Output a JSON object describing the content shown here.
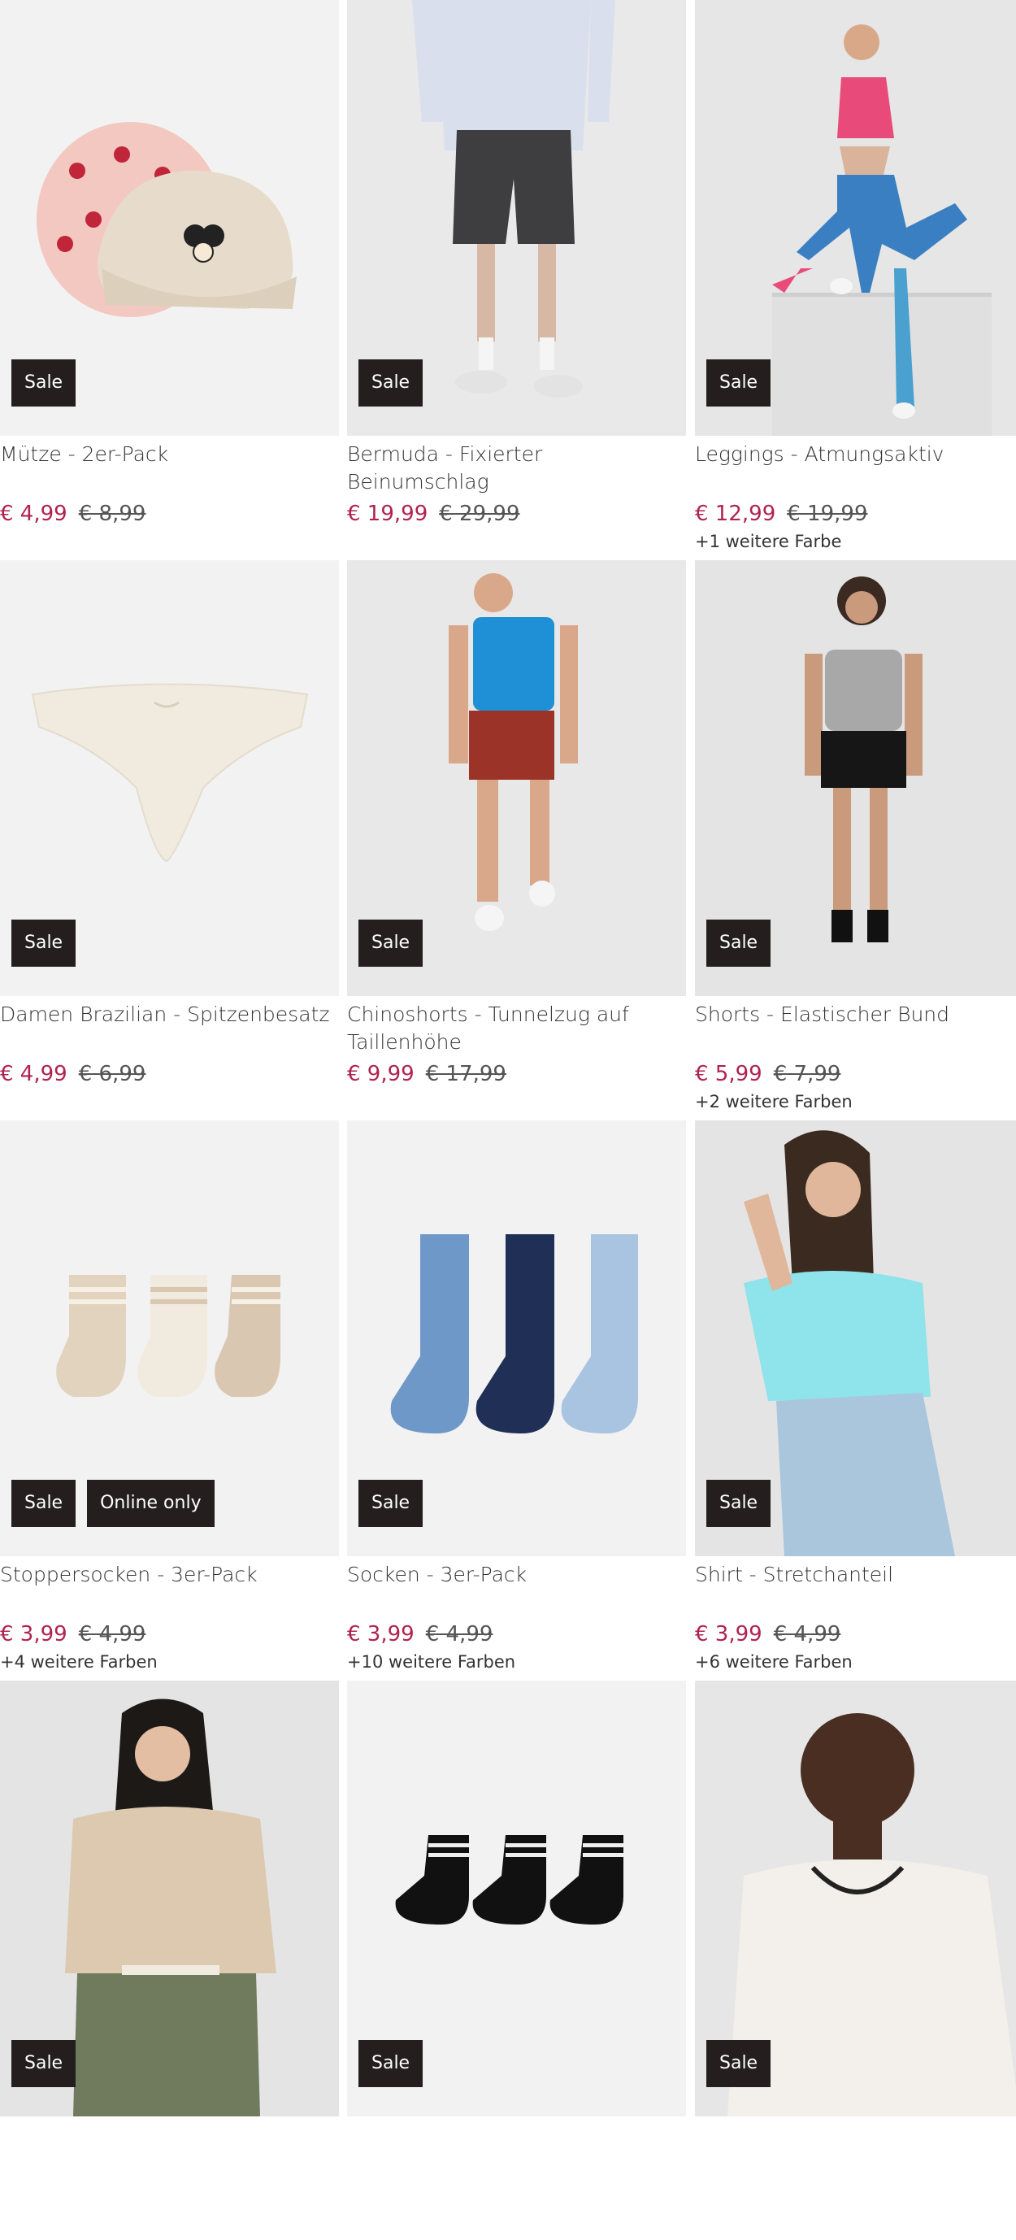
{
  "products": [
    {
      "name": "Mütze - 2er-Pack",
      "price": "€ 4,99",
      "old_price": "€ 8,99",
      "badges": [
        "Sale"
      ],
      "colors": ""
    },
    {
      "name": "Bermuda - Fixierter Beinumschlag",
      "price": "€ 19,99",
      "old_price": "€ 29,99",
      "badges": [
        "Sale"
      ],
      "colors": ""
    },
    {
      "name": "Leggings - Atmungsaktiv",
      "price": "€ 12,99",
      "old_price": "€ 19,99",
      "badges": [
        "Sale"
      ],
      "colors": "+1 weitere Farbe"
    },
    {
      "name": "Damen Brazilian - Spitzenbesatz",
      "price": "€ 4,99",
      "old_price": "€ 6,99",
      "badges": [
        "Sale"
      ],
      "colors": ""
    },
    {
      "name": "Chinoshorts - Tunnelzug auf Taillenhöhe",
      "price": "€ 9,99",
      "old_price": "€ 17,99",
      "badges": [
        "Sale"
      ],
      "colors": ""
    },
    {
      "name": "Shorts - Elastischer Bund",
      "price": "€ 5,99",
      "old_price": "€ 7,99",
      "badges": [
        "Sale"
      ],
      "colors": "+2 weitere Farben"
    },
    {
      "name": "Stoppersocken - 3er-Pack",
      "price": "€ 3,99",
      "old_price": "€ 4,99",
      "badges": [
        "Sale",
        "Online only"
      ],
      "colors": "+4 weitere Farben"
    },
    {
      "name": "Socken - 3er-Pack",
      "price": "€ 3,99",
      "old_price": "€ 4,99",
      "badges": [
        "Sale"
      ],
      "colors": "+10 weitere Farben"
    },
    {
      "name": "Shirt - Stretchanteil",
      "price": "€ 3,99",
      "old_price": "€ 4,99",
      "badges": [
        "Sale"
      ],
      "colors": "+6 weitere Farben"
    },
    {
      "name": "",
      "price": "",
      "old_price": "",
      "badges": [
        "Sale"
      ],
      "colors": ""
    },
    {
      "name": "",
      "price": "",
      "old_price": "",
      "badges": [
        "Sale"
      ],
      "colors": ""
    },
    {
      "name": "",
      "price": "",
      "old_price": "",
      "badges": [
        "Sale"
      ],
      "colors": ""
    }
  ]
}
